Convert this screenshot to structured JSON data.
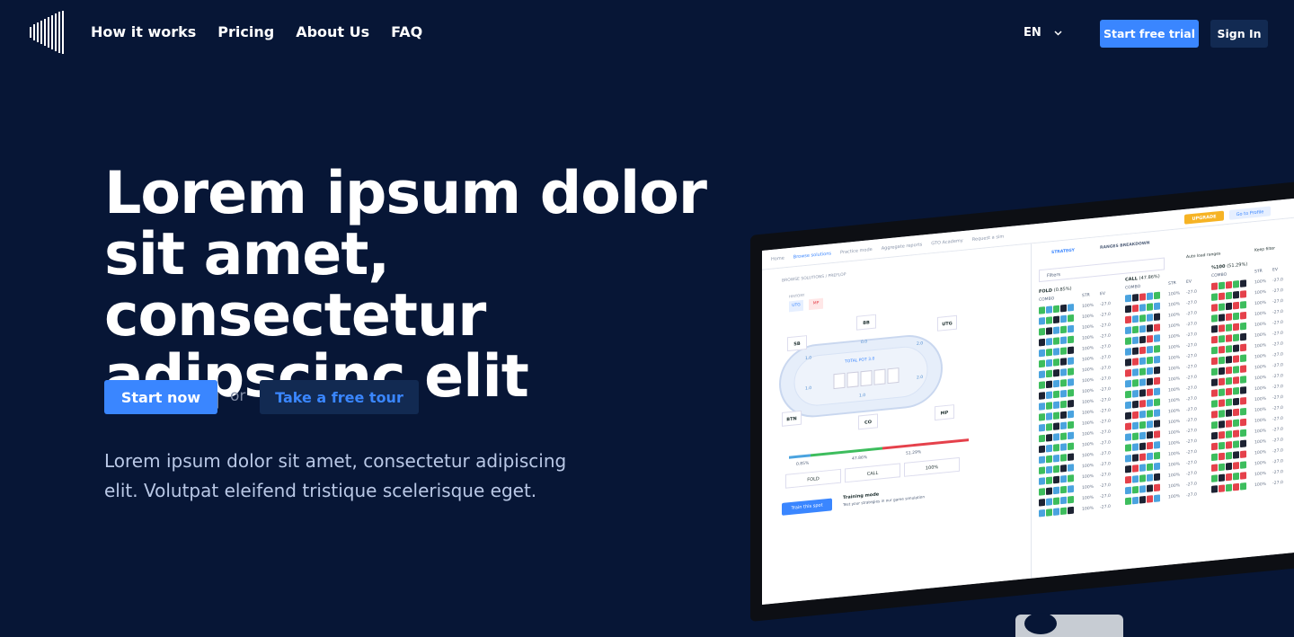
{
  "nav": {
    "links": [
      "How it works",
      "Pricing",
      "About Us",
      "FAQ"
    ],
    "language": "EN",
    "trial_label": "Start free trial",
    "signin_label": "Sign In"
  },
  "hero": {
    "title": "Lorem ipsum dolor sit amet, consectetur adipscinc elit",
    "start_label": "Start now",
    "or_label": "or",
    "tour_label": "Take a free tour",
    "subtitle": "Lorem ipsum dolor sit amet, consectetur adipiscing elit. Volutpat eleifend tristique scelerisque eget."
  },
  "screen": {
    "menu": [
      "Home",
      "Browse solutions",
      "Practice mode",
      "Aggregate reports",
      "GTO Academy",
      "Request a sim"
    ],
    "upgrade_label": "UPGRADE",
    "profile_label": "Go to Profile",
    "tabs": [
      "STRATEGY",
      "RANGES BREAKDOWN"
    ],
    "filter_placeholder": "Filters",
    "auto_load": "Auto load ranges",
    "keep_filter": "Keep filter",
    "breadcrumb": "BROWSE SOLUTIONS / PREFLOP",
    "history_label": "HISTORY",
    "positions": [
      "UTG",
      "MP"
    ],
    "seats": [
      "BB",
      "UTG",
      "SB",
      "MP",
      "BTN",
      "CO"
    ],
    "pot_label": "TOTAL POT",
    "pot_value": "3.0",
    "bets": [
      "0.0",
      "1.0",
      "2.0",
      "1.0",
      "2.0",
      "1.0",
      "1.0"
    ],
    "action_pcts": [
      "0.85%",
      "47.86%",
      "51.29%"
    ],
    "actions": [
      "FOLD",
      "CALL",
      "100%"
    ],
    "train_label": "Train this spot",
    "training_title": "Training mode",
    "training_desc": "Test your strategies in our game simulation",
    "columns": [
      {
        "label": "FOLD",
        "pct": "(0.85%)",
        "color": "#4aa3df"
      },
      {
        "label": "CALL",
        "pct": "(47.86%)",
        "color": "#3dbd5d"
      },
      {
        "label": "%100",
        "pct": "(51.29%)",
        "color": "#e5414b"
      }
    ],
    "col_headers": [
      "COMBO",
      "STR",
      "EV"
    ],
    "str_value": "100%",
    "ev_value": "-27.0"
  }
}
